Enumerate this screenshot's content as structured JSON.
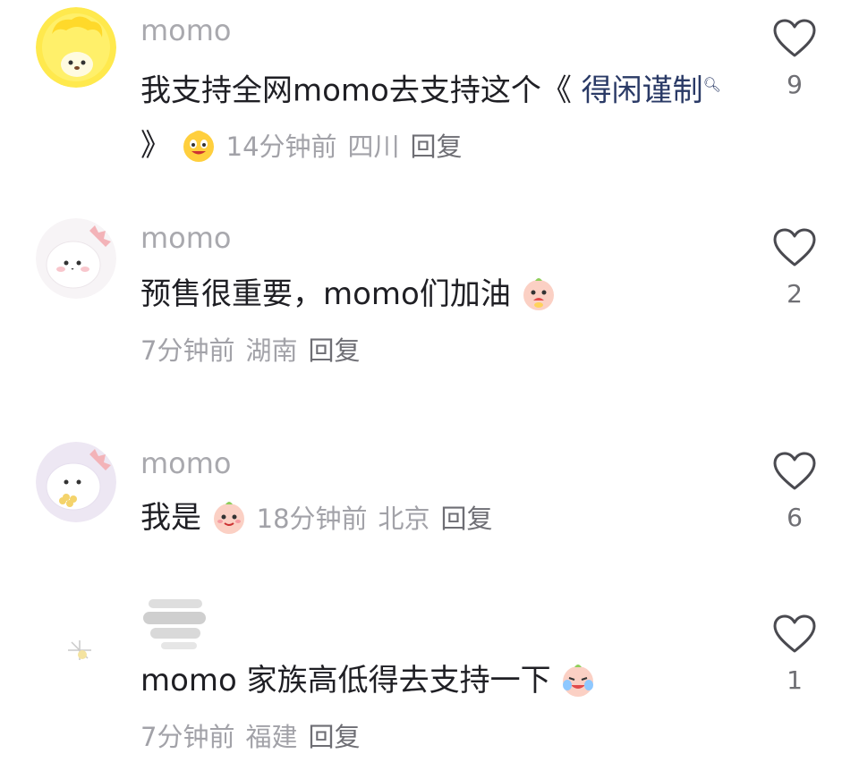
{
  "comments": [
    {
      "username": "momo",
      "text": "我支持全网momo去支持这个《 ",
      "hashtag": "得闲谨制",
      "hashtag_end": " 》",
      "time": "14分钟前",
      "location": "四川",
      "reply_label": "回复",
      "likes": "9"
    },
    {
      "username": "momo",
      "text": "预售很重要，momo们加油",
      "time": "7分钟前",
      "location": "湖南",
      "reply_label": "回复",
      "likes": "2"
    },
    {
      "username": "momo",
      "text": "我是",
      "time": "18分钟前",
      "location": "北京",
      "reply_label": "回复",
      "likes": "6"
    },
    {
      "username": "",
      "text": "momo 家族高低得去支持一下",
      "time": "7分钟前",
      "location": "福建",
      "reply_label": "回复",
      "likes": "1"
    }
  ],
  "icons": {
    "like": "heart-outline-icon",
    "emoji_1": "grinning-face-emoji",
    "emoji_2": "crying-face-emoji",
    "emoji_3": "smiling-face-emoji",
    "emoji_4": "tears-of-joy-emoji"
  },
  "colors": {
    "username": "#a9a9ae",
    "text": "#1f1f24",
    "meta": "#a2a2a8",
    "hashtag": "#2a3a66"
  }
}
